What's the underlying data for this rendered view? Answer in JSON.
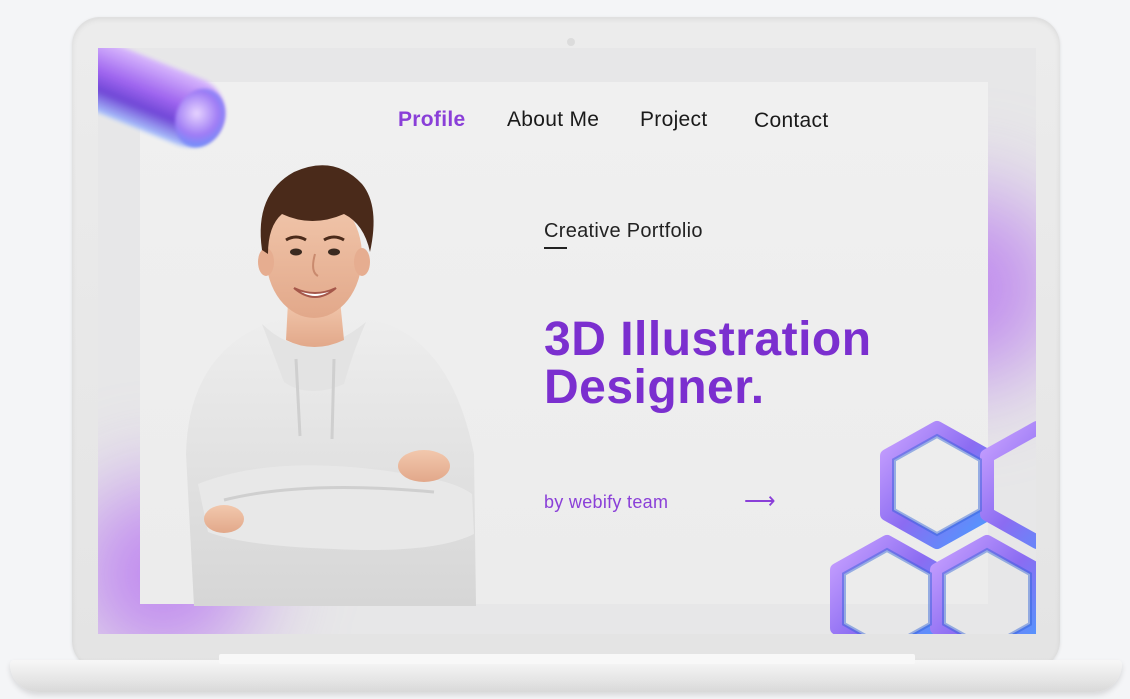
{
  "nav": {
    "items": [
      {
        "label": "Profile",
        "active": true
      },
      {
        "label": "About Me",
        "active": false
      },
      {
        "label": "Project",
        "active": false
      },
      {
        "label": "Contact",
        "active": false
      }
    ]
  },
  "hero": {
    "tagline": "Creative Portfolio",
    "headline_line1": "3D Illustration",
    "headline_line2": "Designer.",
    "byline": "by webify team",
    "arrow": "⟶"
  },
  "colors": {
    "accent": "#8a3fd8",
    "headline": "#7b2fcf",
    "glow": "#b36df0",
    "background": "#ececec"
  },
  "icons": {
    "arrow": "arrow-right-icon",
    "hexagons": "hexagon-3d-icon",
    "tube": "capsule-3d-icon"
  }
}
